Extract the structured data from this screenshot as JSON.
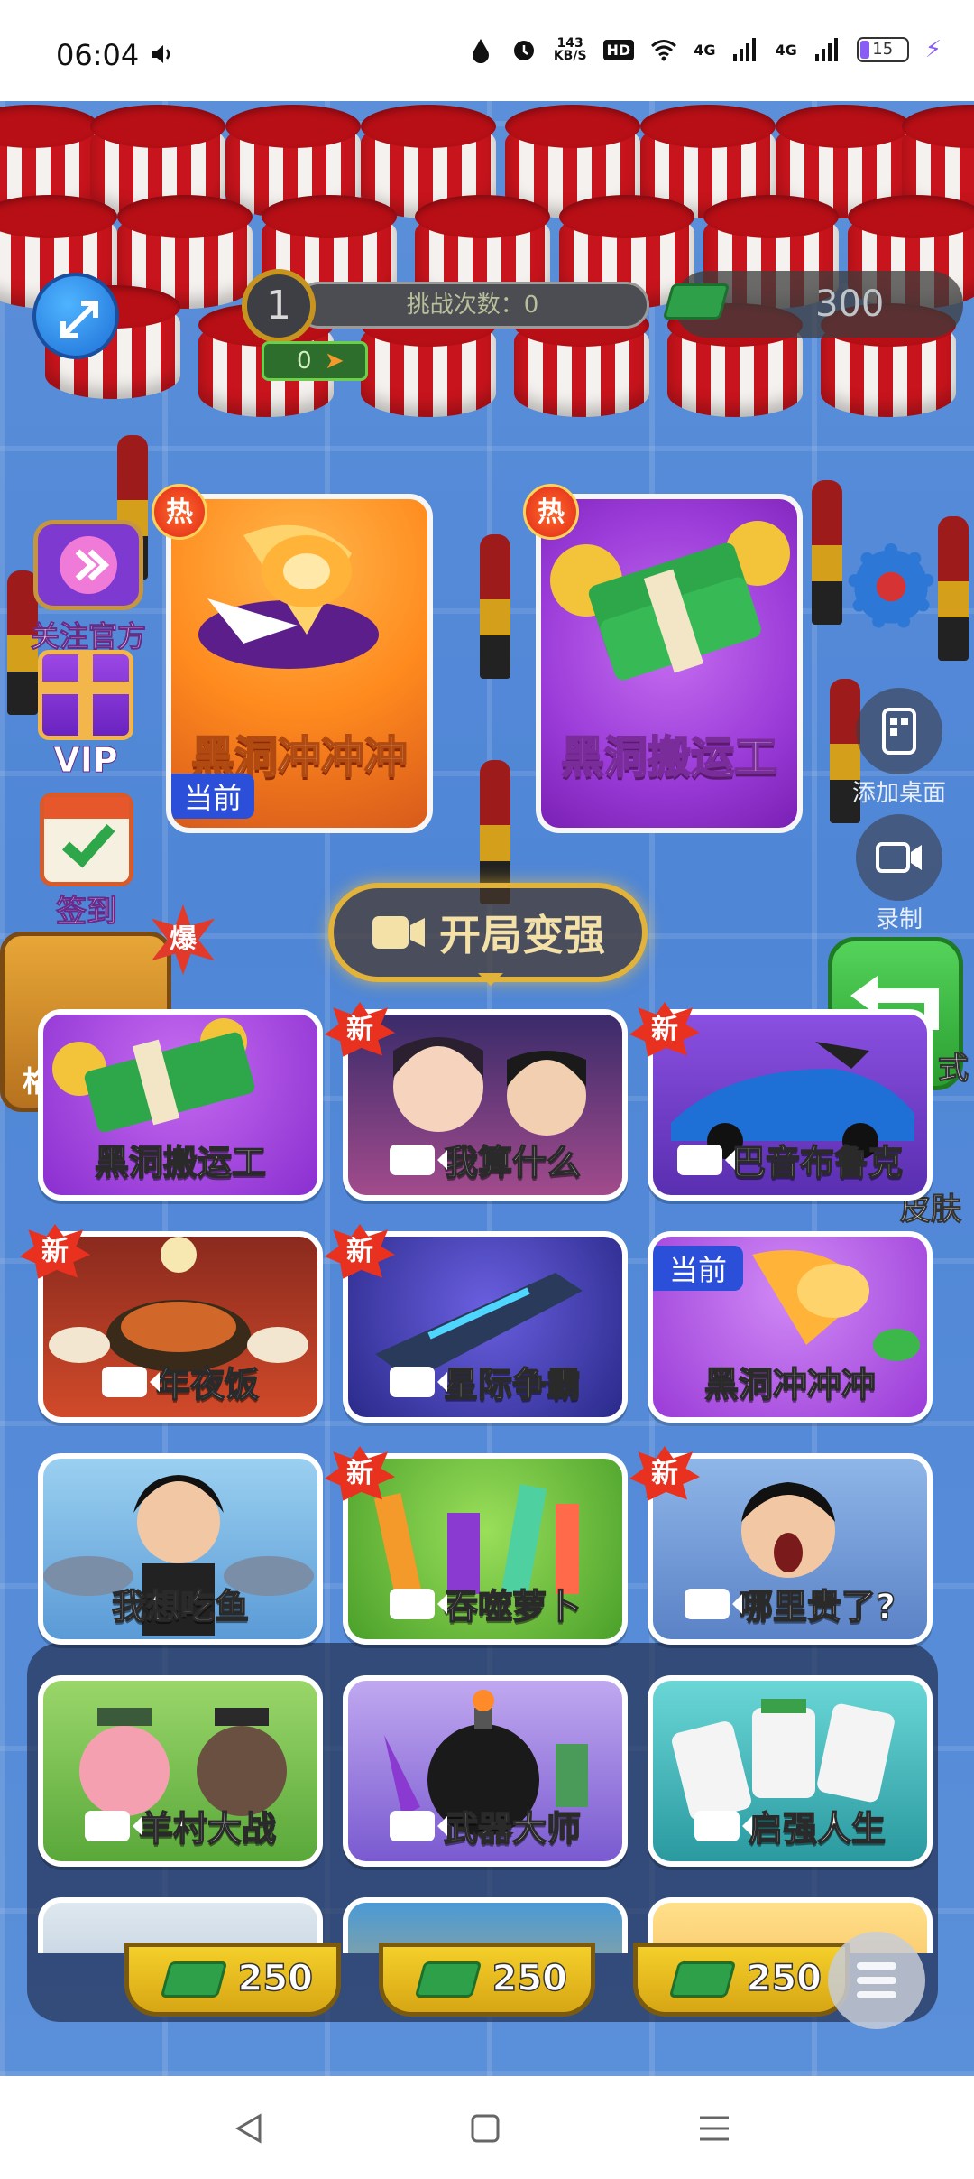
{
  "status_bar": {
    "time": "06:04",
    "net_speed_value": "143",
    "net_speed_unit": "KB/S",
    "hd": "HD",
    "signal_1": "4G",
    "signal_2": "4G",
    "battery": "15"
  },
  "hud": {
    "level": "1",
    "challenge_text": "挑战次数：0",
    "energy": "0",
    "money": "300"
  },
  "featured": [
    {
      "title": "黑洞冲冲冲",
      "badge": "热",
      "current": "当前"
    },
    {
      "title": "黑洞搬运工",
      "badge": "热"
    }
  ],
  "left_side": {
    "official": "关注官方",
    "vip": "VIP",
    "sign_in": "签到",
    "explode_badge": "爆",
    "partial_label": "格"
  },
  "right_side": {
    "add_desktop": "添加桌面",
    "record": "录制",
    "mode_fragment": "式",
    "skin_fragment": "皮肤"
  },
  "start_button": "开局变强",
  "modes": [
    {
      "label": "黑洞搬运工",
      "new": false,
      "video": false
    },
    {
      "label": "我算什么",
      "new": true,
      "video": true
    },
    {
      "label": "巴音布鲁克",
      "new": true,
      "video": true
    },
    {
      "label": "年夜饭",
      "new": true,
      "video": true
    },
    {
      "label": "星际争霸",
      "new": true,
      "video": true
    },
    {
      "label": "黑洞冲冲冲",
      "new": false,
      "video": false,
      "current": "当前"
    },
    {
      "label": "我想吃鱼",
      "new": false,
      "video": false
    },
    {
      "label": "吞噬萝卜",
      "new": true,
      "video": true
    },
    {
      "label": "哪里贵了?",
      "new": true,
      "video": true
    },
    {
      "label": "羊村大战",
      "new": false,
      "video": true
    },
    {
      "label": "武器大师",
      "new": false,
      "video": true
    },
    {
      "label": "启强人生",
      "new": false,
      "video": true
    }
  ],
  "new_badge": "新",
  "prices": [
    "250",
    "250",
    "250"
  ],
  "colors": {
    "accent_gold": "#e2b33a",
    "current_tag": "#2b4fd8",
    "new_badge": "#e8321f"
  }
}
